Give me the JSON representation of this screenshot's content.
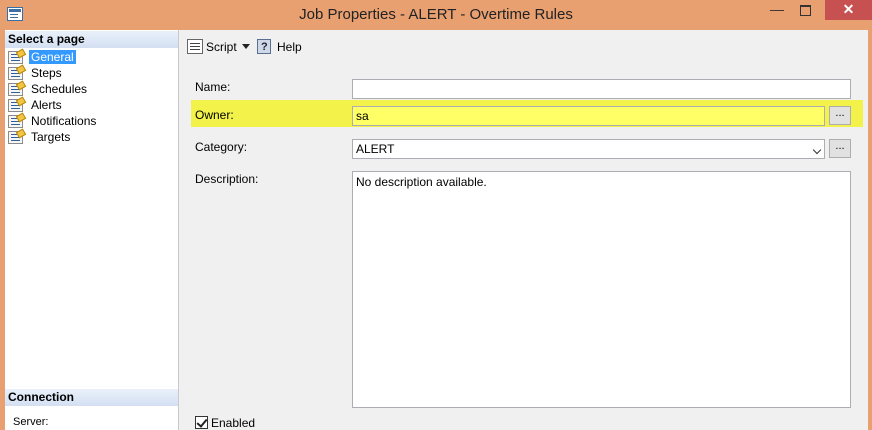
{
  "window": {
    "title": "Job Properties - ALERT - Overtime Rules"
  },
  "left": {
    "select_page_header": "Select a page",
    "pages": [
      {
        "label": "General",
        "selected": true
      },
      {
        "label": "Steps"
      },
      {
        "label": "Schedules"
      },
      {
        "label": "Alerts"
      },
      {
        "label": "Notifications"
      },
      {
        "label": "Targets"
      }
    ],
    "connection_header": "Connection",
    "server_label": "Server:"
  },
  "toolbar": {
    "script_label": "Script",
    "help_label": "Help"
  },
  "form": {
    "name_label": "Name:",
    "name_value": "",
    "owner_label": "Owner:",
    "owner_value": "sa",
    "category_label": "Category:",
    "category_value": "ALERT",
    "description_label": "Description:",
    "description_value": "No description available.",
    "ellipsis": "...",
    "enabled_label": "Enabled",
    "enabled_checked": true
  },
  "colors": {
    "title_bar": "#e9a071",
    "owner_highlight": "#f2f24a",
    "selected_item": "#3399ff",
    "close_button": "#c75050"
  }
}
